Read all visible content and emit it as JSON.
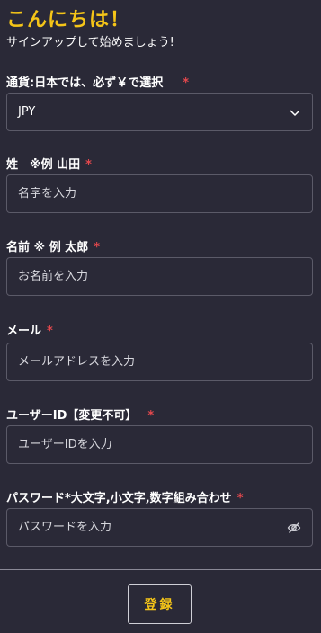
{
  "header": {
    "greeting": "こんにちは！",
    "subtitle": "サインアップして始めましょう!"
  },
  "form": {
    "currency": {
      "label": "通貨:日本では、必ず￥で選択",
      "required_mark": "*",
      "value": "JPY"
    },
    "last_name": {
      "label": "姓　※例 山田",
      "required_mark": "*",
      "placeholder": "名字を入力"
    },
    "first_name": {
      "label": "名前 ※ 例 太郎",
      "required_mark": "*",
      "placeholder": "お名前を入力"
    },
    "email": {
      "label": "メール",
      "required_mark": "*",
      "placeholder": "メールアドレスを入力"
    },
    "user_id": {
      "label": "ユーザーID【変更不可】",
      "required_mark": "*",
      "placeholder": "ユーザーIDを入力"
    },
    "password": {
      "label": "パスワード*大文字,小文字,数字組み合わせ",
      "required_mark": "*",
      "placeholder": "パスワードを入力",
      "toggle_icon": "eye-off-icon"
    }
  },
  "footer": {
    "register_label": "登録"
  },
  "colors": {
    "background": "#2a2937",
    "accent": "#f5c518",
    "required": "#e5484d",
    "border": "#5b5a68"
  }
}
